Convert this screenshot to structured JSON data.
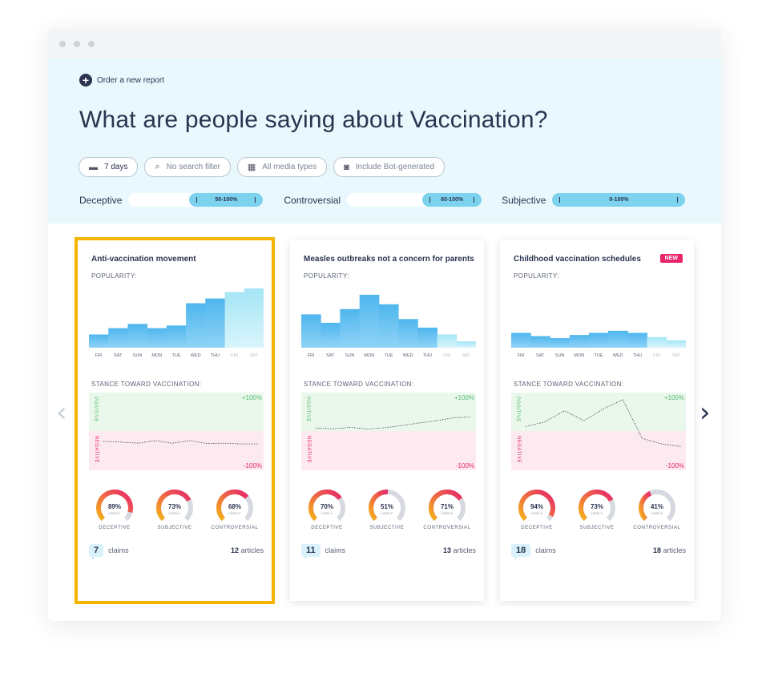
{
  "header": {
    "order_label": "Order a new report",
    "title": "What are people saying about Vaccination?"
  },
  "filters": [
    {
      "label": "7 days",
      "icon": "calendar-icon"
    },
    {
      "label": "No search filter",
      "icon": "search-icon"
    },
    {
      "label": "All media types",
      "icon": "media-icon"
    },
    {
      "label": "Include Bot-generated",
      "icon": "bot-icon"
    }
  ],
  "sliders": [
    {
      "label": "Deceptive",
      "range": "50-100%",
      "from": 0.5,
      "to": 1.0
    },
    {
      "label": "Controversial",
      "range": "60-100%",
      "from": 0.6,
      "to": 1.0
    },
    {
      "label": "Subjective",
      "range": "0-100%",
      "from": 0.0,
      "to": 1.0
    }
  ],
  "labels": {
    "popularity": "POPULARITY:",
    "stance": "STANCE TOWARD VACCINATION:",
    "positive": "POSITIVE",
    "negative": "NEGATIVE",
    "plus100": "+100%",
    "minus100": "-100%",
    "likely": "LIKELY",
    "claims": "claims",
    "articles": "articles",
    "days": [
      "FRI",
      "SAT",
      "SUN",
      "MON",
      "TUE",
      "WED",
      "THU",
      "FRI",
      "SAT"
    ]
  },
  "cards": [
    {
      "title": "Anti-vaccination movement",
      "selected": true,
      "is_new": false,
      "popularity": [
        0.25,
        0.37,
        0.45,
        0.37,
        0.42,
        0.84,
        0.93,
        1.05,
        1.12
      ],
      "stance": [
        -0.28,
        -0.3,
        -0.33,
        -0.26,
        -0.33,
        -0.26,
        -0.34,
        -0.33,
        -0.35,
        -0.35
      ],
      "gauges": [
        {
          "label": "DECEPTIVE",
          "value": "89%",
          "pct": 0.89
        },
        {
          "label": "SUBJECTIVE",
          "value": "73%",
          "pct": 0.73
        },
        {
          "label": "CONTROVERSIAL",
          "value": "68%",
          "pct": 0.68
        }
      ],
      "claims": "7",
      "articles": "12"
    },
    {
      "title": "Measles outbreaks not a concern for parents",
      "selected": false,
      "is_new": false,
      "popularity": [
        0.63,
        0.47,
        0.73,
        1.0,
        0.82,
        0.54,
        0.38,
        0.25,
        0.12
      ],
      "stance": [
        0.08,
        0.06,
        0.1,
        0.05,
        0.09,
        0.15,
        0.22,
        0.28,
        0.36,
        0.38
      ],
      "gauges": [
        {
          "label": "DECEPTIVE",
          "value": "70%",
          "pct": 0.7
        },
        {
          "label": "SUBJECTIVE",
          "value": "51%",
          "pct": 0.51
        },
        {
          "label": "CONTROVERSIAL",
          "value": "71%",
          "pct": 0.71
        }
      ],
      "claims": "11",
      "articles": "13"
    },
    {
      "title": "Childhood vaccination schedules",
      "selected": false,
      "is_new": true,
      "new_label": "NEW",
      "popularity": [
        0.28,
        0.22,
        0.18,
        0.24,
        0.28,
        0.32,
        0.28,
        0.2,
        0.14
      ],
      "stance": [
        0.12,
        0.25,
        0.55,
        0.28,
        0.6,
        0.85,
        -0.2,
        -0.35,
        -0.42
      ],
      "gauges": [
        {
          "label": "DECEPTIVE",
          "value": "94%",
          "pct": 0.94
        },
        {
          "label": "SUBJECTIVE",
          "value": "73%",
          "pct": 0.73
        },
        {
          "label": "CONTROVERSIAL",
          "value": "41%",
          "pct": 0.41
        }
      ],
      "claims": "18",
      "articles": "18"
    }
  ],
  "nav": {
    "prev": "‹",
    "next": "›"
  },
  "colors": {
    "accent": "#2b3350",
    "selection": "#f4b400",
    "bar_top": "#4fb6ee",
    "bar_bottom": "#8fd3f6",
    "bar_future": "#d9f5fb",
    "positive": "#53b96d",
    "negative": "#e8256b",
    "new_badge": "#e8256b"
  }
}
